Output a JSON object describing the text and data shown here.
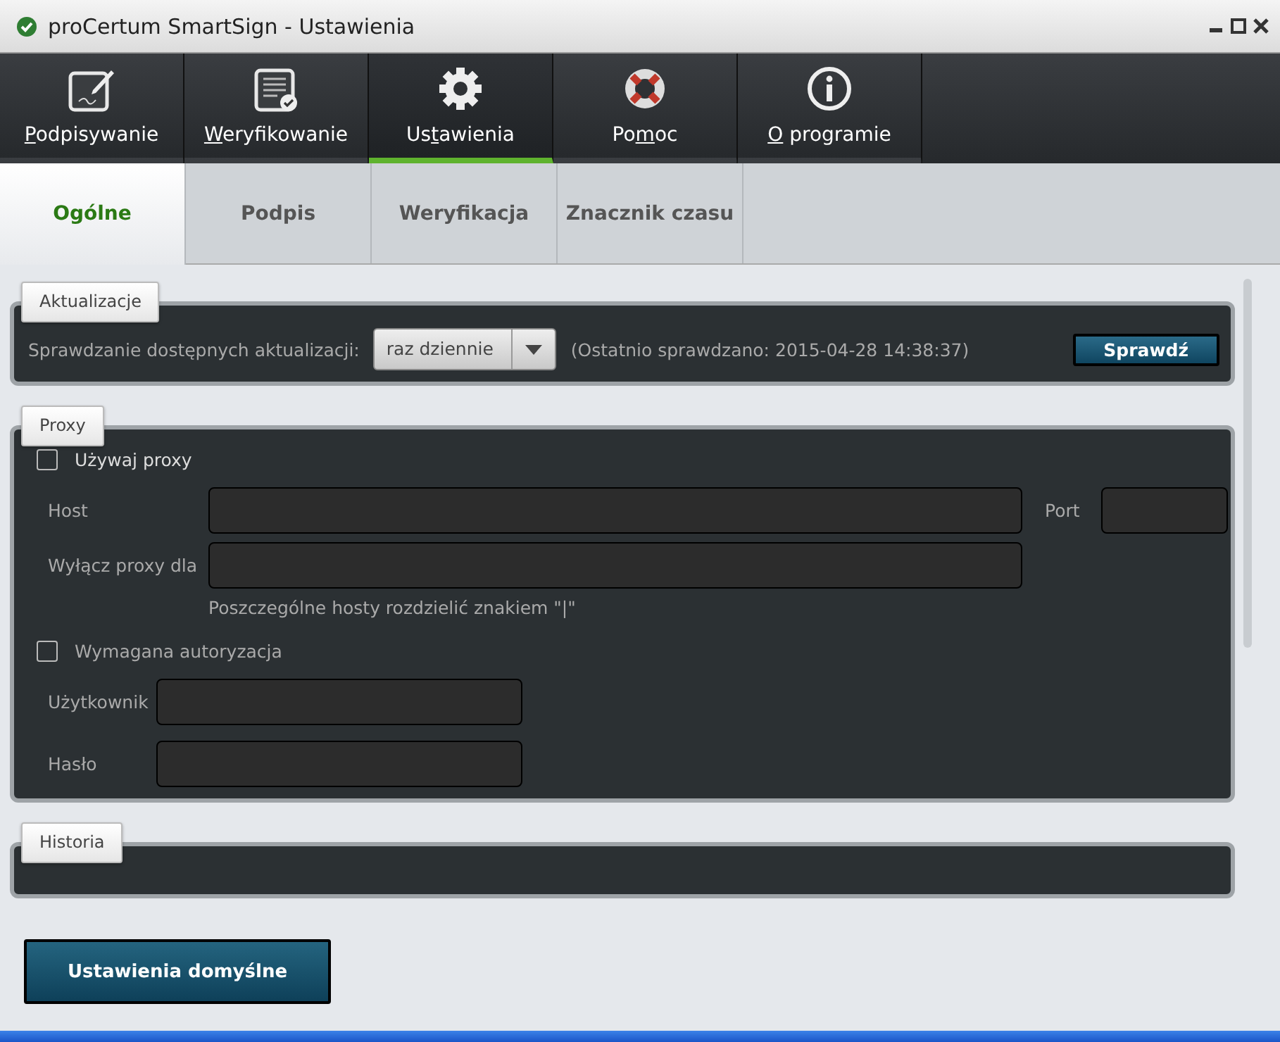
{
  "window": {
    "title": "proCertum SmartSign - Ustawienia"
  },
  "nav": [
    {
      "key": "P",
      "post": "odpisywanie",
      "selected": false
    },
    {
      "key": "W",
      "post": "eryfikowanie",
      "selected": false
    },
    {
      "pre": "Us",
      "key": "t",
      "post": "awienia",
      "selected": true
    },
    {
      "pre": "Po",
      "key": "m",
      "post": "oc",
      "selected": false
    },
    {
      "key": "O",
      "post": " programie",
      "selected": false
    }
  ],
  "subtabs": [
    {
      "label": "Ogólne",
      "selected": true
    },
    {
      "label": "Podpis",
      "selected": false
    },
    {
      "label": "Weryfikacja",
      "selected": false
    },
    {
      "label": "Znacznik czasu",
      "selected": false
    }
  ],
  "updates": {
    "legend": "Aktualizacje",
    "label": "Sprawdzanie dostępnych aktualizacji:",
    "dropdown_value": "raz dziennie",
    "last_checked": "(Ostatnio sprawdzano: 2015-04-28 14:38:37)",
    "button": "Sprawdź"
  },
  "proxy": {
    "legend": "Proxy",
    "use_proxy": {
      "label": "Używaj proxy",
      "checked": false
    },
    "host_label": "Host",
    "port_label": "Port",
    "exclude_label": "Wyłącz proxy dla",
    "hint": "Poszczególne hosty rozdzielić znakiem \"|\"",
    "auth": {
      "label": "Wymagana autoryzacja",
      "checked": false
    },
    "user_label": "Użytkownik",
    "password_label": "Hasło"
  },
  "history": {
    "legend": "Historia"
  },
  "defaults_button": "Ustawienia domyślne"
}
